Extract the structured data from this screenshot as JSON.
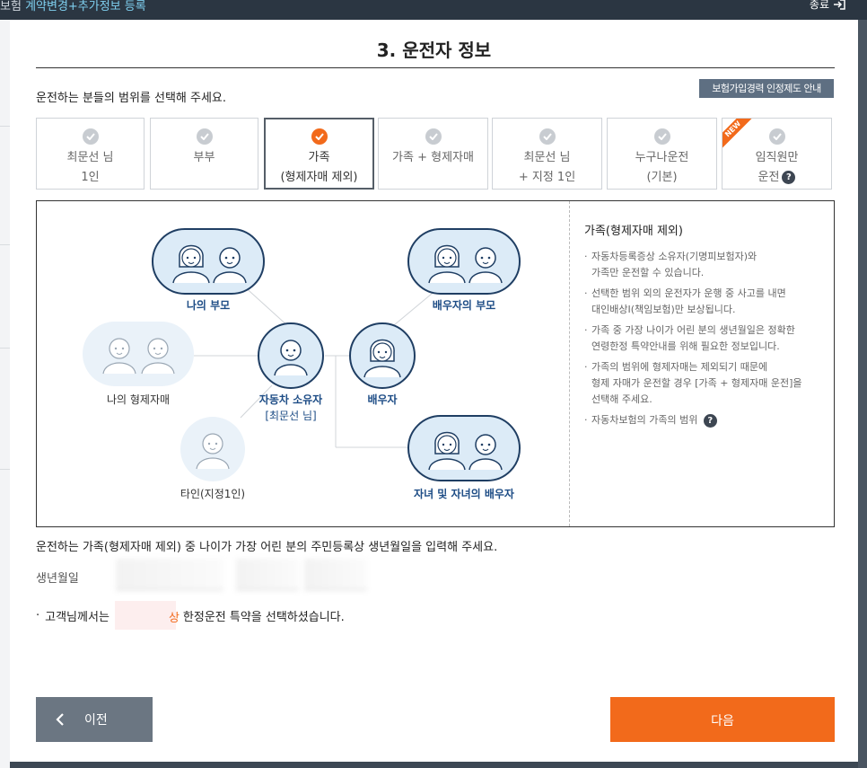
{
  "header": {
    "breadcrumb_prefix": "보험",
    "breadcrumb_highlight": "계약변경+추가정보 등록",
    "close_label": "종료"
  },
  "modal": {
    "title": "3. 운전자 정보",
    "instruction": "운전하는 분들의 범위를 선택해 주세요.",
    "guide_button": "보험가입경력 인정제도 안내"
  },
  "options": [
    {
      "line1": "최문선 님",
      "line2": "1인",
      "selected": false
    },
    {
      "line1": "부부",
      "line2": "",
      "selected": false
    },
    {
      "line1": "가족",
      "line2": "(형제자매 제외)",
      "selected": true
    },
    {
      "line1": "가족 + 형제자매",
      "line2": "",
      "selected": false
    },
    {
      "line1": "최문선 님",
      "line2": "+ 지정 1인",
      "selected": false
    },
    {
      "line1": "누구나운전",
      "line2": "(기본)",
      "selected": false
    },
    {
      "line1": "임직원만",
      "line2": "운전",
      "selected": false,
      "badge": "NEW",
      "help": "?"
    }
  ],
  "diagram": {
    "labels": {
      "my_parents": "나의 부모",
      "spouse_parents": "배우자의 부모",
      "my_siblings": "나의 형제자매",
      "owner": "자동차 소유자",
      "owner_name": "[최문선 님]",
      "spouse": "배우자",
      "other": "타인(지정1인)",
      "children": "자녀 및 자녀의 배우자"
    }
  },
  "info": {
    "title": "가족(형제자매 제외)",
    "items": [
      {
        "a": "자동차등록증상 소유자(기명피보험자)와",
        "b": "가족만 운전할 수 있습니다.",
        "c": ""
      },
      {
        "a": "선택한 범위 외의 운전자가 운행 중 사고를 내면",
        "b": "대인배상I(책임보험)만 보상됩니다.",
        "c": ""
      },
      {
        "a": "가족 중 가장 나이가 어린 분의 생년월일은 정확한",
        "b": "연령한정 특약안내를 위해 필요한 정보입니다.",
        "c": ""
      },
      {
        "a": "가족의 범위에 형제자매는 제외되기 때문에",
        "b": "형제 자매가 운전할 경우 [가족 + 형제자매 운전]을",
        "c": "선택해 주세요."
      },
      {
        "a": "자동차보험의 가족의 범위",
        "b": "",
        "c": ""
      }
    ],
    "help": "?"
  },
  "birth": {
    "title": "운전하는 가족(형제자매 제외) 중 나이가 가장 어린 분의 주민등록상 생년월일을 입력해 주세요.",
    "label": "생년월일",
    "notice_prefix": "고객님께서는",
    "notice_tail": "상",
    "notice_suffix": "한정운전 특약을 선택하셨습니다."
  },
  "footer": {
    "prev_label": "이전",
    "next_label": "다음"
  },
  "colors": {
    "accent": "#f26a1b",
    "navy": "#1e4d86",
    "circle_fill": "#dcebf7",
    "circle_stroke": "#1f3e63"
  }
}
